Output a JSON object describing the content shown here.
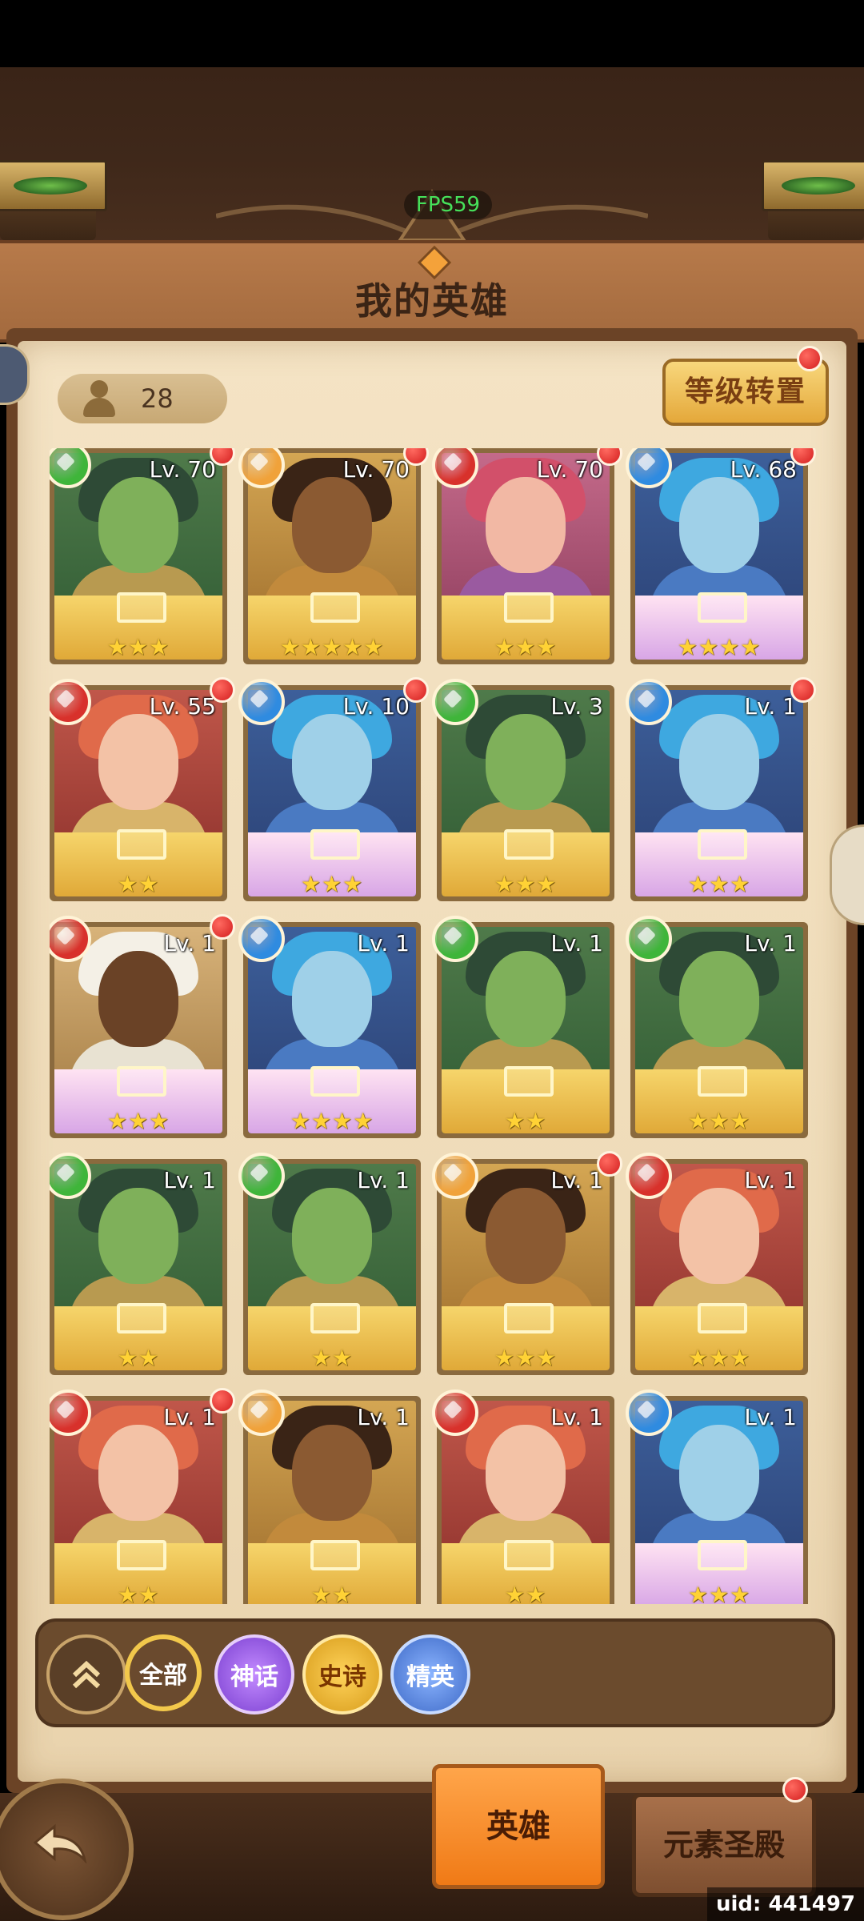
{
  "hud": {
    "fps_label": "FPS59"
  },
  "header": {
    "title": "我的英雄"
  },
  "hero_count": {
    "value": "28"
  },
  "level_transfer": {
    "label": "等级转置"
  },
  "heroes": [
    {
      "level": "Lv. 70",
      "element": "wind",
      "elem_color": "#3fb53a",
      "stars": "★★★",
      "theme": "green",
      "dot": true
    },
    {
      "level": "Lv. 70",
      "element": "earth",
      "elem_color": "#f0a23a",
      "stars": "★★★★★",
      "theme": "gold",
      "dot": true
    },
    {
      "level": "Lv. 70",
      "element": "fire",
      "elem_color": "#d8312b",
      "stars": "★★★",
      "theme": "pink",
      "dot": true
    },
    {
      "level": "Lv. 68",
      "element": "water",
      "elem_color": "#2f8be0",
      "stars": "★★★★",
      "theme": "blue",
      "dot": true
    },
    {
      "level": "Lv. 55",
      "element": "fire",
      "elem_color": "#d8312b",
      "stars": "★★",
      "theme": "red",
      "dot": true
    },
    {
      "level": "Lv. 10",
      "element": "water",
      "elem_color": "#2f8be0",
      "stars": "★★★",
      "theme": "blue",
      "dot": true
    },
    {
      "level": "Lv. 3",
      "element": "wind",
      "elem_color": "#3fb53a",
      "stars": "★★★",
      "theme": "green",
      "dot": false
    },
    {
      "level": "Lv. 1",
      "element": "water",
      "elem_color": "#2f8be0",
      "stars": "★★★",
      "theme": "blue",
      "dot": true
    },
    {
      "level": "Lv. 1",
      "element": "fire",
      "elem_color": "#d8312b",
      "stars": "★★★",
      "theme": "white",
      "dot": true
    },
    {
      "level": "Lv. 1",
      "element": "water",
      "elem_color": "#2f8be0",
      "stars": "★★★★",
      "theme": "blue",
      "dot": false
    },
    {
      "level": "Lv. 1",
      "element": "wind",
      "elem_color": "#3fb53a",
      "stars": "★★",
      "theme": "green",
      "dot": false
    },
    {
      "level": "Lv. 1",
      "element": "wind",
      "elem_color": "#3fb53a",
      "stars": "★★★",
      "theme": "green",
      "dot": false
    },
    {
      "level": "Lv. 1",
      "element": "wind",
      "elem_color": "#3fb53a",
      "stars": "★★",
      "theme": "green",
      "dot": false
    },
    {
      "level": "Lv. 1",
      "element": "wind",
      "elem_color": "#3fb53a",
      "stars": "★★",
      "theme": "green",
      "dot": false
    },
    {
      "level": "Lv. 1",
      "element": "earth",
      "elem_color": "#f0a23a",
      "stars": "★★★",
      "theme": "gold",
      "dot": true
    },
    {
      "level": "Lv. 1",
      "element": "fire",
      "elem_color": "#d8312b",
      "stars": "★★★",
      "theme": "red",
      "dot": false
    },
    {
      "level": "Lv. 1",
      "element": "fire",
      "elem_color": "#d8312b",
      "stars": "★★",
      "theme": "red",
      "dot": true
    },
    {
      "level": "Lv. 1",
      "element": "earth",
      "elem_color": "#f0a23a",
      "stars": "★★",
      "theme": "gold",
      "dot": false
    },
    {
      "level": "Lv. 1",
      "element": "fire",
      "elem_color": "#d8312b",
      "stars": "★★",
      "theme": "red",
      "dot": false
    },
    {
      "level": "Lv. 1",
      "element": "water",
      "elem_color": "#2f8be0",
      "stars": "★★★",
      "theme": "blue",
      "dot": false
    }
  ],
  "filters": {
    "all": "全部",
    "mythic": "神话",
    "epic": "史诗",
    "elite": "精英"
  },
  "tabs": {
    "hero": "英雄",
    "shrine": "元素圣殿"
  },
  "footer": {
    "uid": "uid: 441497"
  }
}
